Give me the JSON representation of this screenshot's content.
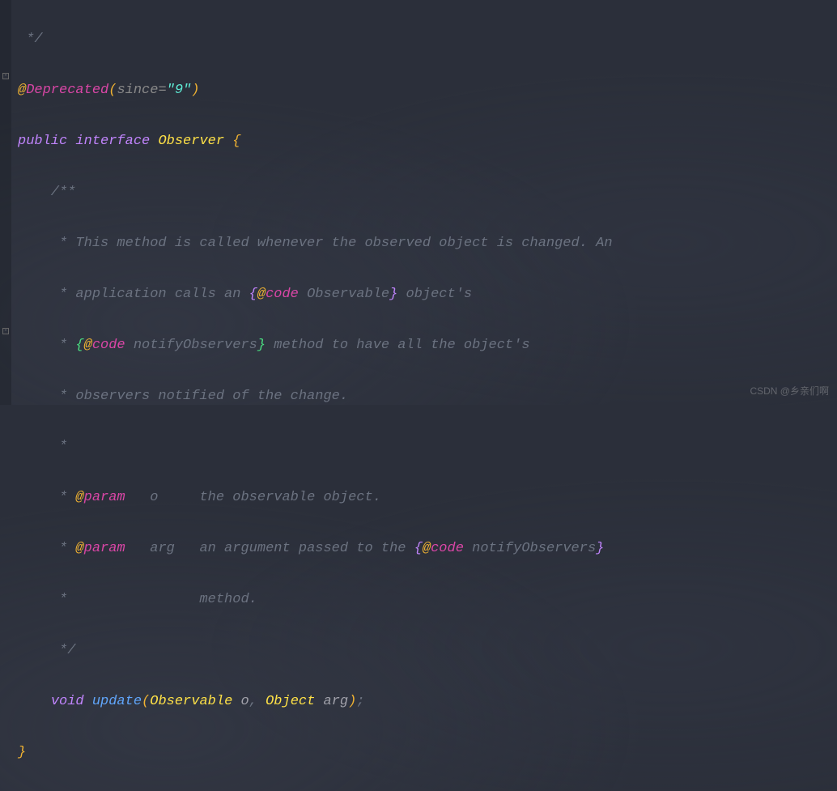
{
  "code": {
    "line0": " */",
    "line1_at": "@",
    "line1_ann": "Deprecated",
    "line1_lp": "(",
    "line1_since": "since",
    "line1_eq": "=",
    "line1_str": "\"9\"",
    "line1_rp": ")",
    "line2_kw1": "public",
    "line2_kw2": "interface",
    "line2_name": "Observer",
    "line2_brace": "{",
    "line3": "    /**",
    "line4": "     * This method is called whenever the observed object is changed. An",
    "line5_pre": "     * application calls an ",
    "line5_lb": "{",
    "line5_at": "@",
    "line5_tag": "code",
    "line5_txt": " Observable",
    "line5_rb": "}",
    "line5_post": " object's",
    "line6_pre": "     * ",
    "line6_lb": "{",
    "line6_at": "@",
    "line6_tag": "code",
    "line6_txt": " notifyObservers",
    "line6_rb": "}",
    "line6_post": " method to have all the object's",
    "line7": "     * observers notified of the change.",
    "line8": "     *",
    "line9_pre": "     * ",
    "line9_at": "@",
    "line9_tag": "param",
    "line9_post": "   o     the observable object.",
    "line10_pre": "     * ",
    "line10_at": "@",
    "line10_tag": "param",
    "line10_mid": "   arg   an argument passed to the ",
    "line10_lb": "{",
    "line10_at2": "@",
    "line10_tag2": "code",
    "line10_txt": " notifyObservers",
    "line10_rb": "}",
    "line11": "     *                method.",
    "line12": "     */",
    "line13_indent": "    ",
    "line13_kw": "void",
    "line13_method": "update",
    "line13_lp": "(",
    "line13_t1": "Observable",
    "line13_v1": " o",
    "line13_c": ",",
    "line13_t2": " Object",
    "line13_v2": " arg",
    "line13_rp": ")",
    "line13_semi": ";",
    "line14": "}"
  },
  "watermark": "CSDN @乡亲们啊"
}
